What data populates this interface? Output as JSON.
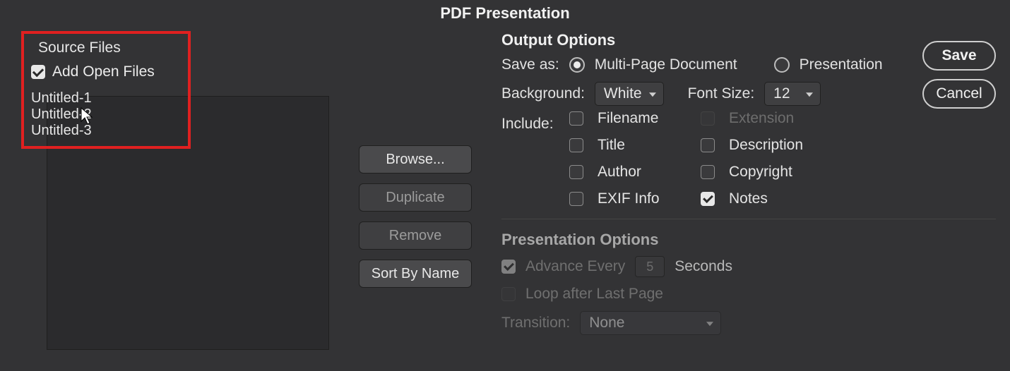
{
  "window_title": "PDF Presentation",
  "source": {
    "title": "Source Files",
    "add_open_files": "Add Open Files",
    "files": [
      "Untitled-1",
      "Untitled-2",
      "Untitled-3"
    ]
  },
  "buttons": {
    "browse": "Browse...",
    "duplicate": "Duplicate",
    "remove": "Remove",
    "sort": "Sort By Name"
  },
  "output": {
    "title": "Output Options",
    "save_as_label": "Save as:",
    "multi_page": "Multi-Page Document",
    "presentation": "Presentation",
    "background_label": "Background:",
    "background_value": "White",
    "font_size_label": "Font Size:",
    "font_size_value": "12",
    "include_label": "Include:",
    "include": {
      "filename": "Filename",
      "extension": "Extension",
      "title": "Title",
      "description": "Description",
      "author": "Author",
      "copyright": "Copyright",
      "exif": "EXIF Info",
      "notes": "Notes"
    }
  },
  "presentation_opts": {
    "title": "Presentation Options",
    "advance": "Advance Every",
    "advance_value": "5",
    "seconds": "Seconds",
    "loop": "Loop after Last Page",
    "transition_label": "Transition:",
    "transition_value": "None"
  },
  "actions": {
    "save": "Save",
    "cancel": "Cancel"
  }
}
